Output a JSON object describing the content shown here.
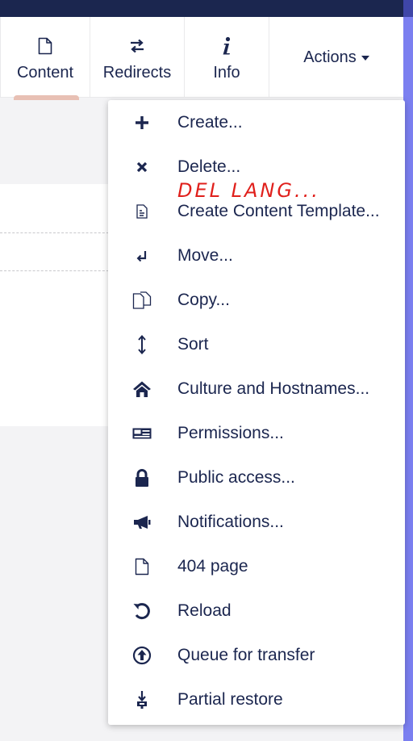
{
  "header": {
    "tabs": [
      {
        "label": "Content",
        "icon": "document-icon"
      },
      {
        "label": "Redirects",
        "icon": "redirect-arrows-icon"
      },
      {
        "label": "Info",
        "icon": "info-icon"
      }
    ],
    "actions_label": "Actions"
  },
  "menu": {
    "items": [
      {
        "label": "Create...",
        "icon": "plus-icon"
      },
      {
        "label": "Delete...",
        "icon": "close-icon"
      },
      {
        "label": "Create Content Template...",
        "icon": "template-icon"
      },
      {
        "label": "Move...",
        "icon": "move-icon"
      },
      {
        "label": "Copy...",
        "icon": "copy-icon"
      },
      {
        "label": "Sort",
        "icon": "sort-icon"
      },
      {
        "label": "Culture and Hostnames...",
        "icon": "home-icon"
      },
      {
        "label": "Permissions...",
        "icon": "permissions-icon"
      },
      {
        "label": "Public access...",
        "icon": "lock-icon"
      },
      {
        "label": "Notifications...",
        "icon": "megaphone-icon"
      },
      {
        "label": "404 page",
        "icon": "page-icon"
      },
      {
        "label": "Reload",
        "icon": "reload-icon"
      },
      {
        "label": "Queue for transfer",
        "icon": "upload-icon"
      },
      {
        "label": "Partial restore",
        "icon": "restore-icon"
      }
    ]
  },
  "annotation": {
    "text": "DEL LANG...",
    "color": "#e0201c"
  },
  "colors": {
    "topbar": "#1b264f",
    "accent_strip": "#7b7ff0",
    "text": "#1b264f",
    "active_tab": "#e8c0b4"
  }
}
